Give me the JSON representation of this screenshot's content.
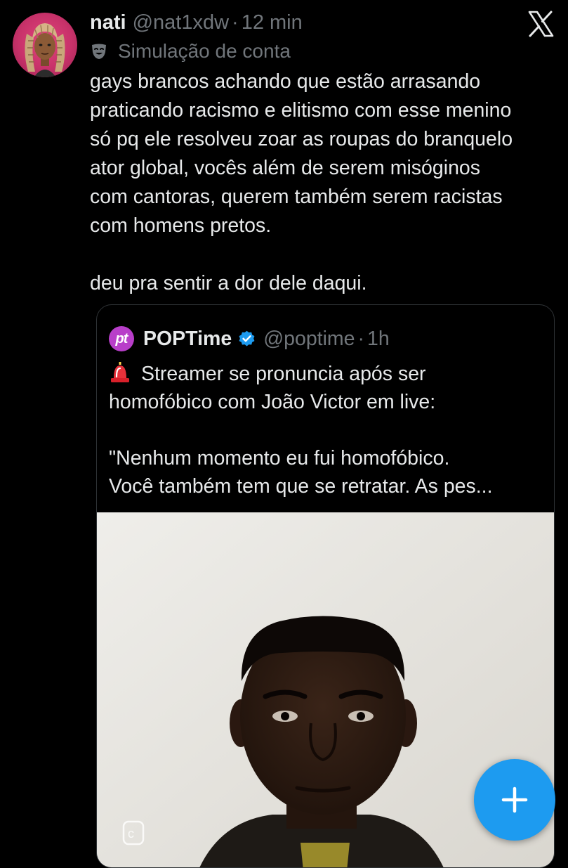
{
  "tweet": {
    "author": {
      "display_name": "nati",
      "handle": "@nat1xdw",
      "separator": "·",
      "time": "12 min",
      "avatar_icon": "profile-avatar"
    },
    "account_label": {
      "icon": "parody-mask-icon",
      "text": "Simulação de conta"
    },
    "text_lines": [
      "gays brancos achando que estão arrasando",
      "praticando racismo e elitismo com esse menino",
      "só pq ele resolveu zoar as roupas do branquelo",
      "ator global, vocês além de serem misóginos",
      "com cantoras, querem também serem racistas",
      "com homens pretos."
    ],
    "text_after_break": "deu pra sentir a dor dele daqui."
  },
  "quoted_tweet": {
    "avatar_text": "pt",
    "name": "POPTime",
    "verified": true,
    "handle": "@poptime",
    "separator": "·",
    "time": "1h",
    "emoji": "🚨",
    "text_lines": [
      "Streamer se pronuncia após ser",
      "homofóbico com João Victor em live:"
    ],
    "text_after_break": [
      "\"Nenhum momento eu fui homofóbico.",
      "Você também tem que se retratar. As pes..."
    ],
    "media": {
      "type": "video-thumbnail"
    }
  },
  "controls": {
    "close_icon": "x-logo-icon",
    "compose_icon": "plus-icon"
  },
  "colors": {
    "background": "#000000",
    "text_primary": "#e7e9ea",
    "text_secondary": "#71767b",
    "accent": "#1d9bf0",
    "border": "#2f3336",
    "quote_avatar": "#b83ec9"
  }
}
